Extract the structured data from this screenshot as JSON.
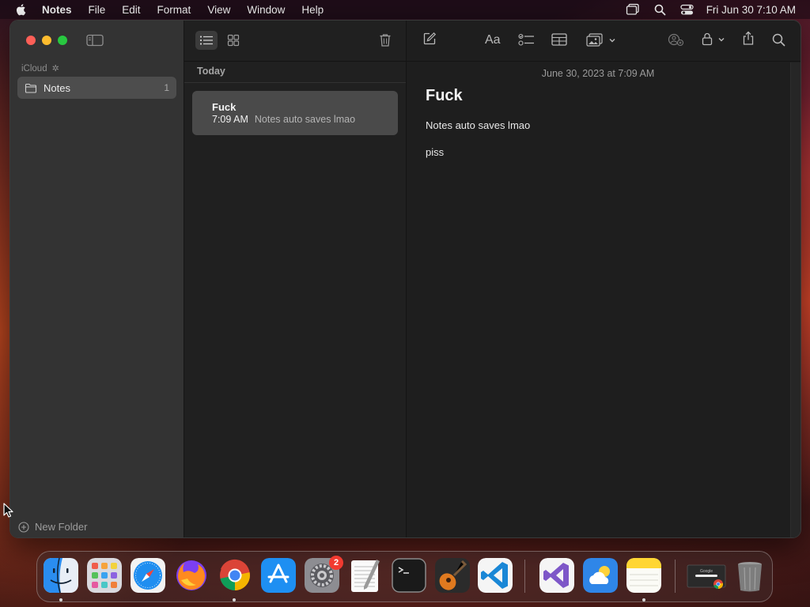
{
  "menubar": {
    "app_name": "Notes",
    "menus": [
      "File",
      "Edit",
      "Format",
      "View",
      "Window",
      "Help"
    ],
    "clock": "Fri Jun 30  7:10 AM"
  },
  "sidebar": {
    "account_label": "iCloud",
    "folders": [
      {
        "name": "Notes",
        "count": "1"
      }
    ],
    "new_folder_label": "New Folder"
  },
  "note_list": {
    "section_header": "Today",
    "notes": [
      {
        "title": "Fuck",
        "time": "7:09 AM",
        "preview": "Notes auto saves lmao"
      }
    ]
  },
  "editor": {
    "date_line": "June 30, 2023 at 7:09 AM",
    "title": "Fuck",
    "body_lines": [
      "Notes auto saves lmao",
      "piss"
    ],
    "format_button_label": "Aa"
  },
  "dock": {
    "apps": [
      "Finder",
      "Launchpad",
      "Safari",
      "Firefox",
      "Google Chrome",
      "App Store",
      "System Settings",
      "TextEdit",
      "Terminal",
      "GarageBand",
      "Visual Studio Code",
      "Visual Studio",
      "Weather",
      "Notes"
    ],
    "settings_badge": "2",
    "minimized_window_label": "Google"
  }
}
